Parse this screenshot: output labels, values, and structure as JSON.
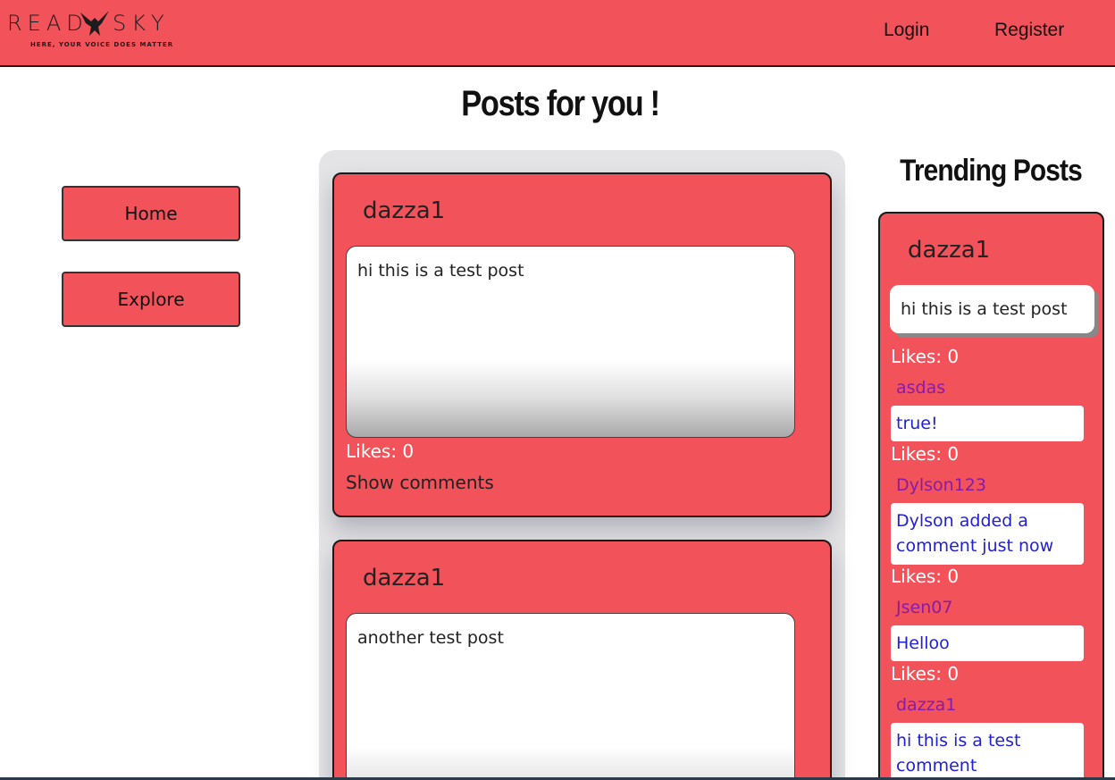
{
  "header": {
    "logo_left": "READ",
    "logo_right": "SKY",
    "logo_tagline": "HERE, YOUR VOICE DOES MATTER",
    "login_label": "Login",
    "register_label": "Register"
  },
  "page_title": "Posts for you !",
  "sidebar": {
    "home_label": "Home",
    "explore_label": "Explore"
  },
  "feed": {
    "posts": [
      {
        "author": "dazza1",
        "body": "hi this is a test post",
        "likes": "Likes: 0",
        "show_comments": "Show comments"
      },
      {
        "author": "dazza1",
        "body": "another test post"
      }
    ]
  },
  "trending": {
    "title": "Trending Posts",
    "post": {
      "author": "dazza1",
      "body": "hi this is a test post",
      "likes": "Likes: 0"
    },
    "comments": [
      {
        "author": "asdas",
        "text": "true!",
        "likes": "Likes: 0"
      },
      {
        "author": "Dylson123",
        "text": "Dylson added a comment just now",
        "likes": "Likes: 0"
      },
      {
        "author": "Jsen07",
        "text": "Helloo",
        "likes": "Likes: 0"
      },
      {
        "author": "dazza1",
        "text": "hi this is a test comment"
      }
    ]
  },
  "colors": {
    "accent": "#f2525a",
    "commenter": "#8a1aa8",
    "comment_text": "#2020d8"
  }
}
